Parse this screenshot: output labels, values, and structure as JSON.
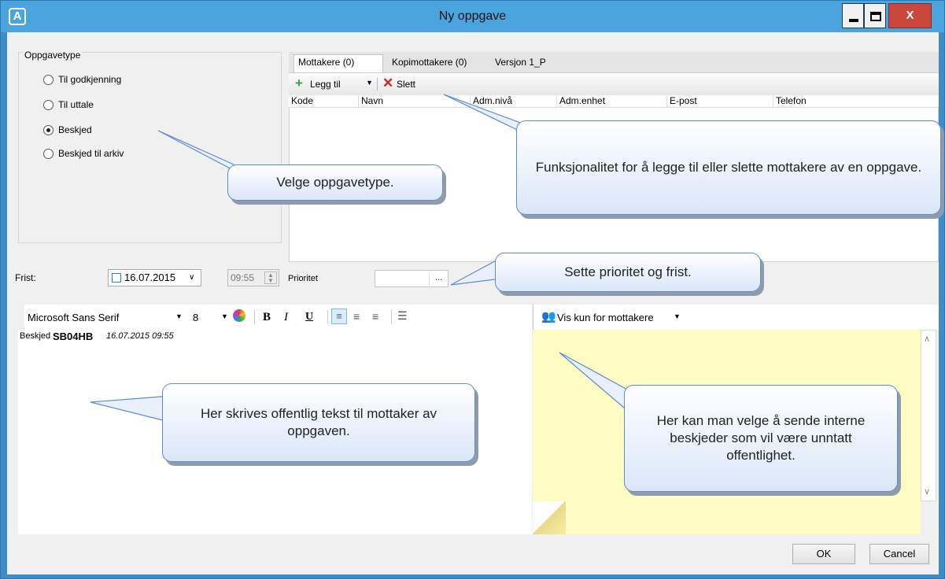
{
  "window": {
    "title": "Ny oppgave",
    "app_icon": "A",
    "close_glyph": "X"
  },
  "task_type": {
    "group_label": "Oppgavetype",
    "options": [
      {
        "label": "Til godkjenning",
        "selected": false
      },
      {
        "label": "Til uttale",
        "selected": false
      },
      {
        "label": "Beskjed",
        "selected": true
      },
      {
        "label": "Beskjed til arkiv",
        "selected": false
      }
    ]
  },
  "tabs": [
    {
      "label": "Mottakere (0)",
      "active": true
    },
    {
      "label": "Kopimottakere (0)",
      "active": false
    },
    {
      "label": "Versjon 1_P",
      "active": false
    }
  ],
  "toolbar": {
    "add_label": "Legg til",
    "delete_label": "Slett"
  },
  "grid_columns": [
    "Kode",
    "Navn",
    "Adm.nivå",
    "Adm.enhet",
    "E-post",
    "Telefon"
  ],
  "deadline": {
    "label": "Frist:",
    "date": "16.07.2015",
    "time": "09:55"
  },
  "priority": {
    "label": "Prioritet",
    "button": "..."
  },
  "format_bar": {
    "font": "Microsoft Sans Serif",
    "size": "8",
    "bold": "B",
    "italic": "I",
    "underline": "U"
  },
  "editor": {
    "prefix": "Beskjed",
    "user": "SB04HB",
    "timestamp": "16.07.2015 09:55"
  },
  "note_bar": {
    "visibility": "Vis kun for mottakere"
  },
  "buttons": {
    "ok": "OK",
    "cancel": "Cancel"
  },
  "callouts": {
    "task_type": "Velge oppgavetype.",
    "recipients": "Funksjonalitet for å legge til eller slette mottakere av en oppgave.",
    "priority": "Sette prioritet og frist.",
    "public_text": "Her skrives offentlig tekst til mottaker av oppgaven.",
    "internal": "Her kan man velge å sende interne beskjeder som vil være unntatt offentlighet."
  },
  "colors": {
    "titlebar": "#4aa4dd",
    "close_button": "#c9473d",
    "note_background": "#fefbc3",
    "callout_border": "#5f8cd0"
  }
}
